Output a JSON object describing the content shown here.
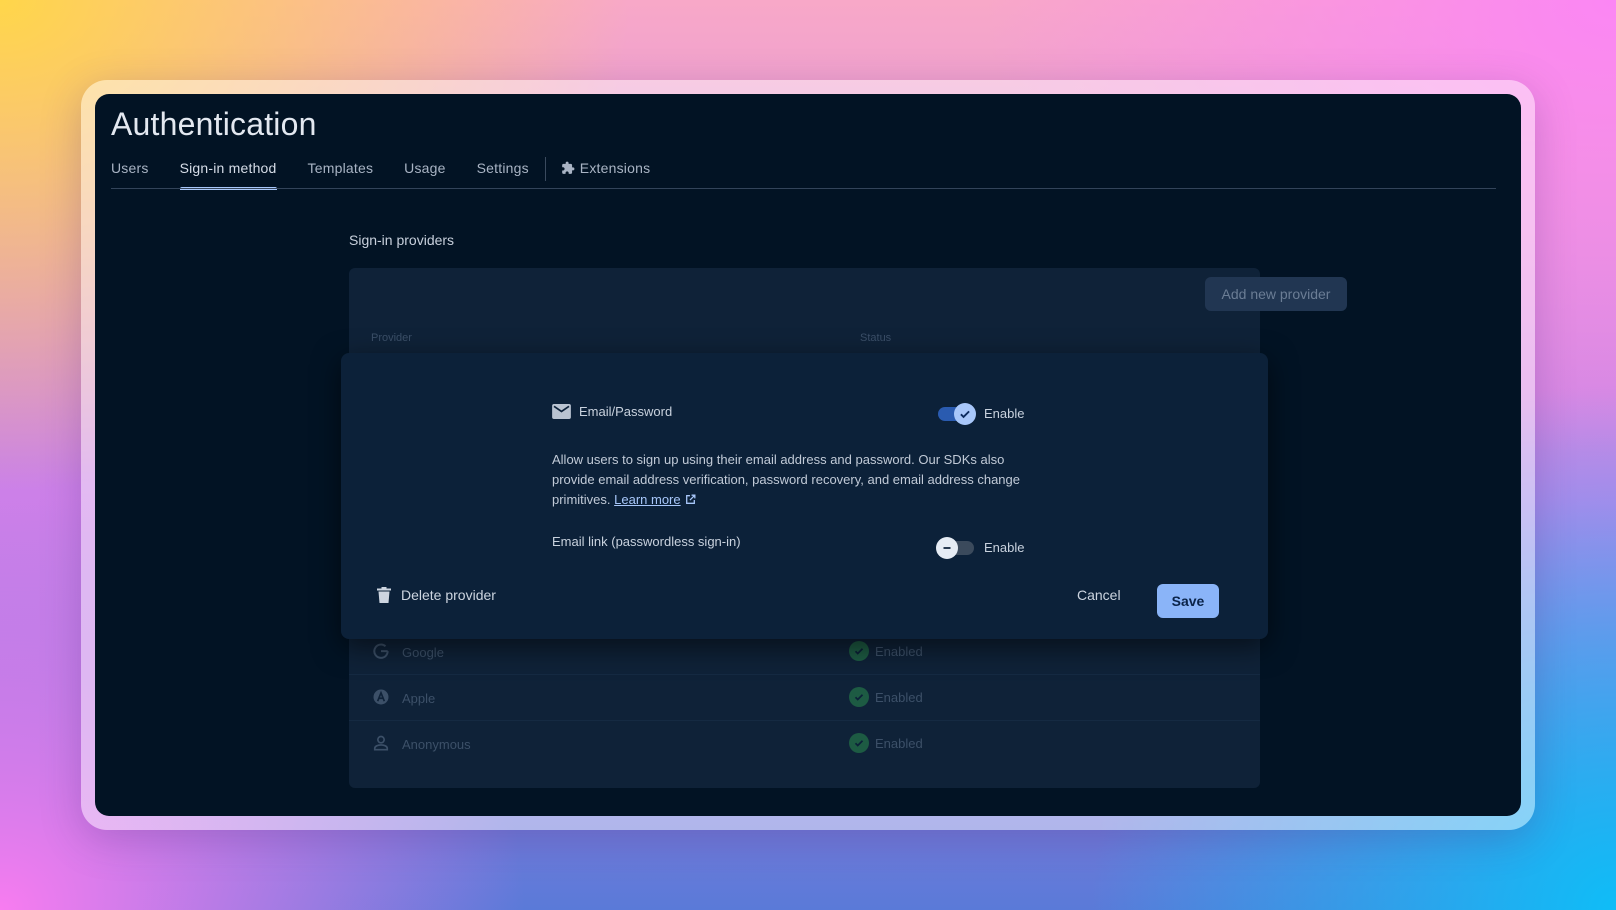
{
  "header": {
    "title": "Authentication"
  },
  "tabs": [
    {
      "label": "Users"
    },
    {
      "label": "Sign-in method",
      "active": true
    },
    {
      "label": "Templates"
    },
    {
      "label": "Usage"
    },
    {
      "label": "Settings"
    },
    {
      "label": "Extensions",
      "icon": "puzzle-icon"
    }
  ],
  "providers": {
    "section_title": "Sign-in providers",
    "add_button": "Add new provider",
    "columns": {
      "provider": "Provider",
      "status": "Status"
    },
    "rows": [
      {
        "name": "Google",
        "icon": "google-icon",
        "status": "Enabled"
      },
      {
        "name": "Apple",
        "icon": "apple-icon",
        "status": "Enabled"
      },
      {
        "name": "Anonymous",
        "icon": "person-icon",
        "status": "Enabled"
      }
    ]
  },
  "editor": {
    "provider_name": "Email/Password",
    "provider_icon": "mail-icon",
    "enable_toggle": {
      "label": "Enable",
      "on": true
    },
    "description_text": "Allow users to sign up using their email address and password. Our SDKs also provide email address verification, password recovery, and email address change primitives.",
    "learn_more": "Learn more",
    "email_link_label": "Email link (passwordless sign-in)",
    "email_link_toggle": {
      "label": "Enable",
      "on": false
    },
    "delete_label": "Delete provider",
    "cancel_label": "Cancel",
    "save_label": "Save"
  },
  "colors": {
    "window_bg": "#021324",
    "card_bg": "#0f2238",
    "modal_bg": "#0c2139",
    "accent": "#a8c7fa",
    "primary_button": "#8ab4f8",
    "enabled_green": "#1d5b43"
  }
}
